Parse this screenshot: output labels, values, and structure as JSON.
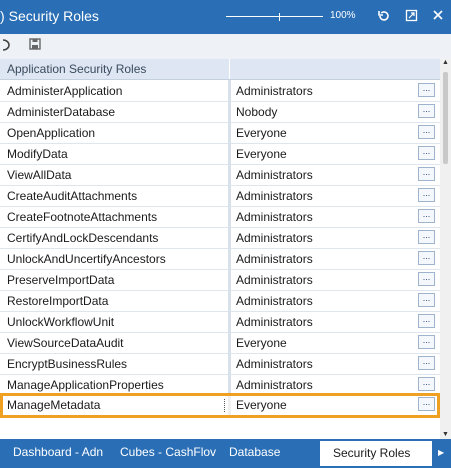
{
  "window": {
    "title": "Security Roles",
    "title_prefix": ")",
    "zoom_label": "100%",
    "icons": [
      "refresh-icon",
      "restore-icon",
      "close-icon"
    ]
  },
  "toolbar": {
    "icons": [
      "undo-icon",
      "save-icon"
    ]
  },
  "grid": {
    "header": "Application Security Roles",
    "rows": [
      {
        "name": "AdministerApplication",
        "value": "Administrators"
      },
      {
        "name": "AdministerDatabase",
        "value": "Nobody"
      },
      {
        "name": "OpenApplication",
        "value": "Everyone"
      },
      {
        "name": "ModifyData",
        "value": "Everyone"
      },
      {
        "name": "ViewAllData",
        "value": "Administrators"
      },
      {
        "name": "CreateAuditAttachments",
        "value": "Administrators"
      },
      {
        "name": "CreateFootnoteAttachments",
        "value": "Administrators"
      },
      {
        "name": "CertifyAndLockDescendants",
        "value": "Administrators"
      },
      {
        "name": "UnlockAndUncertifyAncestors",
        "value": "Administrators"
      },
      {
        "name": "PreserveImportData",
        "value": "Administrators"
      },
      {
        "name": "RestoreImportData",
        "value": "Administrators"
      },
      {
        "name": "UnlockWorkflowUnit",
        "value": "Administrators"
      },
      {
        "name": "ViewSourceDataAudit",
        "value": "Everyone"
      },
      {
        "name": "EncryptBusinessRules",
        "value": "Administrators"
      },
      {
        "name": "ManageApplicationProperties",
        "value": "Administrators"
      },
      {
        "name": "ManageMetadata",
        "value": "Everyone",
        "selected": true
      }
    ],
    "ellipsis": "..."
  },
  "tabs": [
    {
      "label": "Dashboard - Adn"
    },
    {
      "label": "Cubes - CashFlov"
    },
    {
      "label": "Database"
    },
    {
      "label": "Security Roles",
      "active": true
    }
  ],
  "colors": {
    "accent": "#2a6fb6",
    "selection": "#f0a020",
    "header_bg": "#dde6f2"
  }
}
